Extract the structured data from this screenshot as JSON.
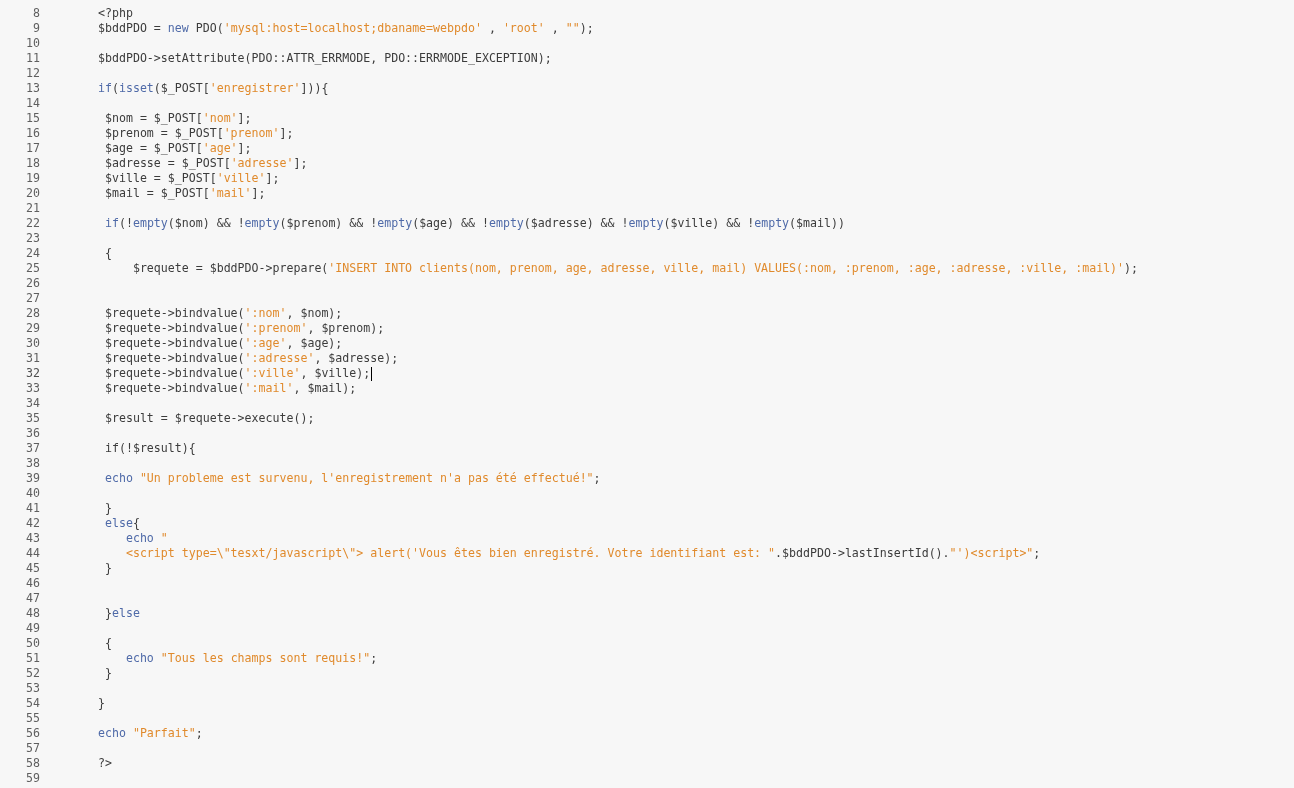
{
  "editor": {
    "lines": [
      {
        "number": "8",
        "cursor": false,
        "tokens": [
          {
            "kind": "plain",
            "text": "<?php"
          }
        ]
      },
      {
        "number": "9",
        "cursor": false,
        "tokens": [
          {
            "kind": "plain",
            "text": "$bddPDO = "
          },
          {
            "kind": "keyword",
            "text": "new"
          },
          {
            "kind": "plain",
            "text": " PDO("
          },
          {
            "kind": "string",
            "text": "'mysql:host=localhost;dbaname=webpdo'"
          },
          {
            "kind": "plain",
            "text": " , "
          },
          {
            "kind": "string",
            "text": "'root'"
          },
          {
            "kind": "plain",
            "text": " , "
          },
          {
            "kind": "string",
            "text": "\"\""
          },
          {
            "kind": "plain",
            "text": ");"
          }
        ]
      },
      {
        "number": "10",
        "cursor": false
      },
      {
        "number": "11",
        "cursor": false,
        "tokens": [
          {
            "kind": "plain",
            "text": "$bddPDO->setAttribute(PDO::ATTR_ERRMODE, PDO::ERRMODE_EXCEPTION);"
          }
        ]
      },
      {
        "number": "12",
        "cursor": false
      },
      {
        "number": "13",
        "cursor": false,
        "tokens": [
          {
            "kind": "keyword",
            "text": "if"
          },
          {
            "kind": "plain",
            "text": "("
          },
          {
            "kind": "keyword",
            "text": "isset"
          },
          {
            "kind": "plain",
            "text": "($_POST["
          },
          {
            "kind": "string",
            "text": "'enregistrer'"
          },
          {
            "kind": "plain",
            "text": "])){"
          }
        ]
      },
      {
        "number": "14",
        "cursor": false
      },
      {
        "number": "15",
        "cursor": false,
        "tokens": [
          {
            "kind": "plain",
            "text": " $nom = $_POST["
          },
          {
            "kind": "string",
            "text": "'nom'"
          },
          {
            "kind": "plain",
            "text": "];"
          }
        ]
      },
      {
        "number": "16",
        "cursor": false,
        "tokens": [
          {
            "kind": "plain",
            "text": " $prenom = $_POST["
          },
          {
            "kind": "string",
            "text": "'prenom'"
          },
          {
            "kind": "plain",
            "text": "];"
          }
        ]
      },
      {
        "number": "17",
        "cursor": false,
        "tokens": [
          {
            "kind": "plain",
            "text": " $age = $_POST["
          },
          {
            "kind": "string",
            "text": "'age'"
          },
          {
            "kind": "plain",
            "text": "];"
          }
        ]
      },
      {
        "number": "18",
        "cursor": false,
        "tokens": [
          {
            "kind": "plain",
            "text": " $adresse = $_POST["
          },
          {
            "kind": "string",
            "text": "'adresse'"
          },
          {
            "kind": "plain",
            "text": "];"
          }
        ]
      },
      {
        "number": "19",
        "cursor": false,
        "tokens": [
          {
            "kind": "plain",
            "text": " $ville = $_POST["
          },
          {
            "kind": "string",
            "text": "'ville'"
          },
          {
            "kind": "plain",
            "text": "];"
          }
        ]
      },
      {
        "number": "20",
        "cursor": false,
        "tokens": [
          {
            "kind": "plain",
            "text": " $mail = $_POST["
          },
          {
            "kind": "string",
            "text": "'mail'"
          },
          {
            "kind": "plain",
            "text": "];"
          }
        ]
      },
      {
        "number": "21",
        "cursor": false
      },
      {
        "number": "22",
        "cursor": false,
        "tokens": [
          {
            "kind": "keyword",
            "text": " if"
          },
          {
            "kind": "plain",
            "text": "(!"
          },
          {
            "kind": "keyword",
            "text": "empty"
          },
          {
            "kind": "plain",
            "text": "($nom) && !"
          },
          {
            "kind": "keyword",
            "text": "empty"
          },
          {
            "kind": "plain",
            "text": "($prenom) && !"
          },
          {
            "kind": "keyword",
            "text": "empty"
          },
          {
            "kind": "plain",
            "text": "($age) && !"
          },
          {
            "kind": "keyword",
            "text": "empty"
          },
          {
            "kind": "plain",
            "text": "($adresse) && !"
          },
          {
            "kind": "keyword",
            "text": "empty"
          },
          {
            "kind": "plain",
            "text": "($ville) && !"
          },
          {
            "kind": "keyword",
            "text": "empty"
          },
          {
            "kind": "plain",
            "text": "($mail))"
          }
        ]
      },
      {
        "number": "23",
        "cursor": false
      },
      {
        "number": "24",
        "cursor": false,
        "tokens": [
          {
            "kind": "plain",
            "text": " {"
          }
        ]
      },
      {
        "number": "25",
        "cursor": false,
        "tokens": [
          {
            "kind": "plain",
            "text": "     $requete = $bddPDO->prepare("
          },
          {
            "kind": "string",
            "text": "'INSERT INTO clients(nom, prenom, age, adresse, ville, mail) VALUES(:nom, :prenom, :age, :adresse, :ville, :mail)'"
          },
          {
            "kind": "plain",
            "text": ");"
          }
        ]
      },
      {
        "number": "26",
        "cursor": false
      },
      {
        "number": "27",
        "cursor": false
      },
      {
        "number": "28",
        "cursor": false,
        "tokens": [
          {
            "kind": "plain",
            "text": " $requete->bindvalue("
          },
          {
            "kind": "string",
            "text": "':nom'"
          },
          {
            "kind": "plain",
            "text": ", $nom);"
          }
        ]
      },
      {
        "number": "29",
        "cursor": false,
        "tokens": [
          {
            "kind": "plain",
            "text": " $requete->bindvalue("
          },
          {
            "kind": "string",
            "text": "':prenom'"
          },
          {
            "kind": "plain",
            "text": ", $prenom);"
          }
        ]
      },
      {
        "number": "30",
        "cursor": false,
        "tokens": [
          {
            "kind": "plain",
            "text": " $requete->bindvalue("
          },
          {
            "kind": "string",
            "text": "':age'"
          },
          {
            "kind": "plain",
            "text": ", $age);"
          }
        ]
      },
      {
        "number": "31",
        "cursor": false,
        "tokens": [
          {
            "kind": "plain",
            "text": " $requete->bindvalue("
          },
          {
            "kind": "string",
            "text": "':adresse'"
          },
          {
            "kind": "plain",
            "text": ", $adresse);"
          }
        ]
      },
      {
        "number": "32",
        "cursor": true,
        "tokens": [
          {
            "kind": "plain",
            "text": " $requete->bindvalue("
          },
          {
            "kind": "string",
            "text": "':ville'"
          },
          {
            "kind": "plain",
            "text": ", $ville);"
          }
        ]
      },
      {
        "number": "33",
        "cursor": false,
        "tokens": [
          {
            "kind": "plain",
            "text": " $requete->bindvalue("
          },
          {
            "kind": "string",
            "text": "':mail'"
          },
          {
            "kind": "plain",
            "text": ", $mail);"
          }
        ]
      },
      {
        "number": "34",
        "cursor": false
      },
      {
        "number": "35",
        "cursor": false,
        "tokens": [
          {
            "kind": "plain",
            "text": " $result = $requete->execute();"
          }
        ]
      },
      {
        "number": "36",
        "cursor": false
      },
      {
        "number": "37",
        "cursor": false,
        "tokens": [
          {
            "kind": "plain",
            "text": " if(!$result){"
          }
        ]
      },
      {
        "number": "38",
        "cursor": false
      },
      {
        "number": "39",
        "cursor": false,
        "tokens": [
          {
            "kind": "keyword",
            "text": " echo "
          },
          {
            "kind": "string",
            "text": "\"Un probleme est survenu, l'enregistrement n'a pas été effectué!\""
          },
          {
            "kind": "plain",
            "text": ";"
          }
        ]
      },
      {
        "number": "40",
        "cursor": false
      },
      {
        "number": "41",
        "cursor": false,
        "tokens": [
          {
            "kind": "plain",
            "text": " }"
          }
        ]
      },
      {
        "number": "42",
        "cursor": false,
        "tokens": [
          {
            "kind": "keyword",
            "text": " else"
          },
          {
            "kind": "plain",
            "text": "{"
          }
        ]
      },
      {
        "number": "43",
        "cursor": false,
        "tokens": [
          {
            "kind": "keyword",
            "text": "    echo "
          },
          {
            "kind": "string",
            "text": "\""
          }
        ]
      },
      {
        "number": "44",
        "cursor": false,
        "tokens": [
          {
            "kind": "string",
            "text": "    <script type=\\\"tesxt/javascript\\\"> alert('Vous êtes bien enregistré. Votre identifiant est: \""
          },
          {
            "kind": "plain",
            "text": ".$bddPDO->lastInsertId()."
          },
          {
            "kind": "string",
            "text": "\"')<script>\""
          },
          {
            "kind": "plain",
            "text": ";"
          }
        ]
      },
      {
        "number": "45",
        "cursor": false,
        "tokens": [
          {
            "kind": "plain",
            "text": " }"
          }
        ]
      },
      {
        "number": "46",
        "cursor": false
      },
      {
        "number": "47",
        "cursor": false
      },
      {
        "number": "48",
        "cursor": false,
        "tokens": [
          {
            "kind": "plain",
            "text": " }"
          },
          {
            "kind": "keyword",
            "text": "else"
          }
        ]
      },
      {
        "number": "49",
        "cursor": false
      },
      {
        "number": "50",
        "cursor": false,
        "tokens": [
          {
            "kind": "plain",
            "text": " {"
          }
        ]
      },
      {
        "number": "51",
        "cursor": false,
        "tokens": [
          {
            "kind": "keyword",
            "text": "    echo "
          },
          {
            "kind": "string",
            "text": "\"Tous les champs sont requis!\""
          },
          {
            "kind": "plain",
            "text": ";"
          }
        ]
      },
      {
        "number": "52",
        "cursor": false,
        "tokens": [
          {
            "kind": "plain",
            "text": " }"
          }
        ]
      },
      {
        "number": "53",
        "cursor": false
      },
      {
        "number": "54",
        "cursor": false,
        "tokens": [
          {
            "kind": "plain",
            "text": "}"
          }
        ]
      },
      {
        "number": "55",
        "cursor": false
      },
      {
        "number": "56",
        "cursor": false,
        "tokens": [
          {
            "kind": "keyword",
            "text": "echo "
          },
          {
            "kind": "string",
            "text": "\"Parfait\""
          },
          {
            "kind": "plain",
            "text": ";"
          }
        ]
      },
      {
        "number": "57",
        "cursor": false
      },
      {
        "number": "58",
        "cursor": false,
        "tokens": [
          {
            "kind": "plain",
            "text": "?>"
          }
        ]
      },
      {
        "number": "59",
        "cursor": false
      }
    ]
  }
}
